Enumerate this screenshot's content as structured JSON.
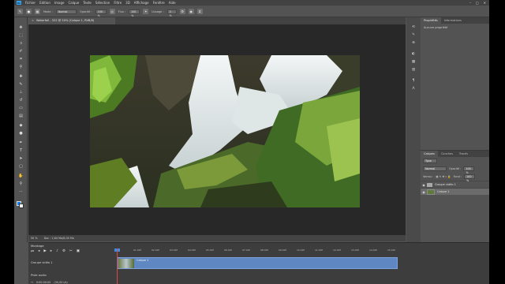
{
  "menubar": {
    "logo": "Ps",
    "items": [
      "Fichier",
      "Edition",
      "Image",
      "Calque",
      "Texte",
      "Sélection",
      "Filtre",
      "3D",
      "Affichage",
      "Fenêtre",
      "Aide"
    ],
    "window_controls": [
      "–",
      "□",
      "✕"
    ]
  },
  "options_bar": {
    "mode_label": "Mode :",
    "mode_value": "Normal",
    "opacity_label": "Opacité :",
    "opacity_value": "100 %",
    "flow_label": "Flux :",
    "flow_value": "100 %",
    "smoothing_label": "Lissage :",
    "smoothing_value": "0 %"
  },
  "document": {
    "tab_label": "Waterfall - 322 @ 50% (Calque 1, RVB/8)",
    "close_symbol": "×"
  },
  "statusbar": {
    "zoom": "50 %",
    "doc_info": "Doc : 2,64 Mo/8,00 Mo"
  },
  "properties_panel": {
    "tabs": [
      "Propriétés",
      "Informations"
    ],
    "empty_message": "Aucune propriété"
  },
  "layers_panel": {
    "tabs": [
      "Calques",
      "Couches",
      "Tracés"
    ],
    "kind_value": "Type",
    "blend_value": "Normal",
    "opacity_label": "Opacité :",
    "opacity_value": "100 %",
    "lock_label": "Verrou :",
    "fill_label": "Fond :",
    "fill_value": "100 %",
    "layers": [
      {
        "name": "Groupe vidéo 1",
        "type": "group"
      },
      {
        "name": "Calque 1",
        "type": "layer"
      }
    ]
  },
  "timeline": {
    "title": "Montage",
    "track_video": "Groupe vidéo 1",
    "track_audio": "Piste audio",
    "clip_label": "Calque 1",
    "timecode": "0:00:00:00",
    "fps": "(30,00 i/s)",
    "ruler_ticks": [
      "00",
      "01:00f",
      "02:00f",
      "03:00f",
      "04:00f",
      "05:00f",
      "06:00f",
      "07:00f",
      "08:00f",
      "09:00f",
      "10:00f",
      "11:00f",
      "12:00f",
      "13:00f",
      "14:00f",
      "15:00f",
      "16:00f"
    ]
  },
  "icons": {
    "tools": [
      "move-icon",
      "marquee-icon",
      "lasso-icon",
      "quick-select-icon",
      "crop-icon",
      "eyedropper-icon",
      "healing-icon",
      "brush-icon",
      "stamp-icon",
      "history-brush-icon",
      "eraser-icon",
      "gradient-icon",
      "blur-icon",
      "dodge-icon",
      "pen-icon",
      "type-icon",
      "path-select-icon",
      "shape-icon",
      "hand-icon",
      "zoom-icon"
    ]
  },
  "colors": {
    "foreground": "#1380e8",
    "background": "#ffffff",
    "clip": "#5f87c2"
  }
}
